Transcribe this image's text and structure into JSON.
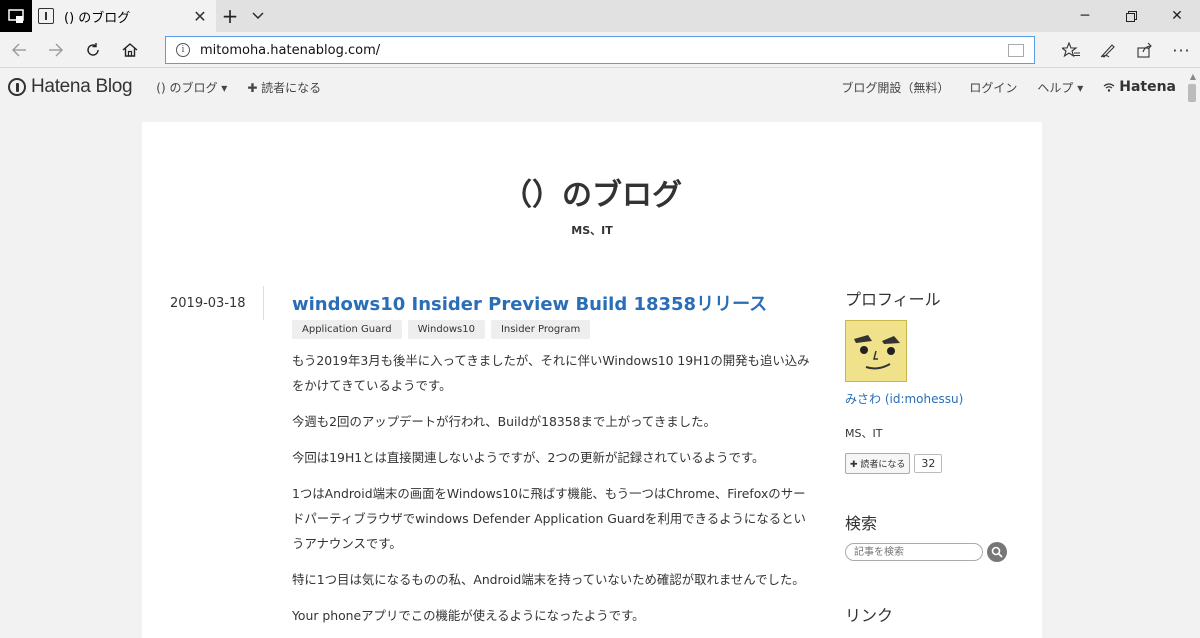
{
  "browser": {
    "tab_title": "() のブログ",
    "url": "mitomoha.hatenablog.com/"
  },
  "hatena_bar": {
    "logo": "Hatena Blog",
    "blog_menu": "() のブログ ▾",
    "subscribe": "✚ 読者になる",
    "start_blog": "ブログ開設（無料）",
    "login": "ログイン",
    "help": "ヘルプ ▾",
    "hatena": "Hatena"
  },
  "blog": {
    "title": "（）のブログ",
    "description": "MS、IT"
  },
  "entry": {
    "date": "2019-03-18",
    "title": "windows10 Insider Preview Build 18358リリース",
    "tags": [
      "Application Guard",
      "Windows10",
      "Insider Program"
    ],
    "paragraphs": [
      "もう2019年3月も後半に入ってきましたが、それに伴いWindows10 19H1の開発も追い込みをかけてきているようです。",
      "今週も2回のアップデートが行われ、Buildが18358まで上がってきました。",
      "今回は19H1とは直接関連しないようですが、2つの更新が記録されているようです。",
      "1つはAndroid端末の画面をWindows10に飛ばす機能、もう一つはChrome、Firefoxのサードパーティブラウザでwindows Defender Application Guardを利用できるようになるというアナウンスです。",
      "特に1つ目は気になるものの私、Android端末を持っていないため確認が取れませんでした。",
      "Your phoneアプリでこの機能が使えるようになったようです。"
    ]
  },
  "sidebar": {
    "profile_heading": "プロフィール",
    "profile_name": "みさわ (id:mohessu)",
    "profile_desc": "MS、IT",
    "subscribe_button": "✚ 読者になる",
    "subscriber_count": "32",
    "search_heading": "検索",
    "search_placeholder": "記事を検索",
    "links_heading": "リンク"
  }
}
